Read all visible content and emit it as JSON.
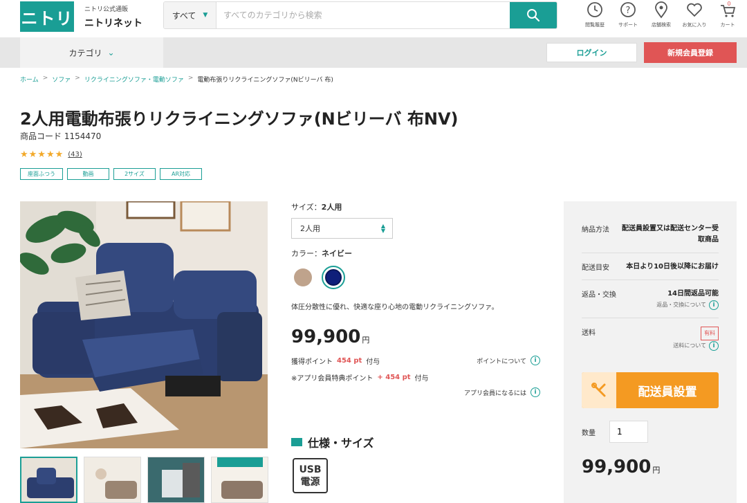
{
  "header": {
    "logo_text": "ニトリ",
    "brand_small": "ニトリ公式通販",
    "brand_name": "ニトリネット",
    "search_category": "すべて",
    "search_placeholder": "すべてのカテゴリから検索",
    "icons": [
      {
        "name": "history-icon",
        "label": "閲覧履歴"
      },
      {
        "name": "support-icon",
        "label": "サポート"
      },
      {
        "name": "store-icon",
        "label": "店舗検索"
      },
      {
        "name": "favorite-icon",
        "label": "お気に入り"
      },
      {
        "name": "cart-icon",
        "label": "カート",
        "count": "0"
      }
    ]
  },
  "subnav": {
    "category_label": "カテゴリ",
    "login_label": "ログイン",
    "register_label": "新規会員登録"
  },
  "breadcrumb": [
    "ホーム",
    "ソファ",
    "リクライニングソファ・電動ソファ",
    "電動布張りリクライニングソファ(Nビリーバ 布)"
  ],
  "product": {
    "title": "2人用電動布張りリクライニングソファ(Nビリーバ 布NV)",
    "code_label": "商品コード",
    "code": "1154470",
    "stars": "★★★★★",
    "review_count": "(43)",
    "tags": [
      "座面ふつう",
      "動画",
      "2サイズ",
      "AR対応"
    ],
    "size_label": "サイズ：",
    "size_value": "2人用",
    "size_select": "2人用",
    "color_label": "カラー：",
    "color_value": "ネイビー",
    "description": "体圧分散性に優れ、快適な座り心地の電動リクライニングソファ。",
    "price": "99,900",
    "yen": "円",
    "points_label": "獲得ポイント",
    "points_value": "454 pt",
    "points_suffix": "付与",
    "points_about": "ポイントについて",
    "app_points_label": "※アプリ会員特典ポイント",
    "app_points_value": "+ 454 pt",
    "app_points_suffix": "付与",
    "app_member_link": "アプリ会員になるには",
    "spec_title": "仕様・サイズ",
    "usb_line1": "USB",
    "usb_line2": "電源"
  },
  "panel": {
    "rows": [
      {
        "key": "納品方法",
        "value": "配送員設置又は配送センター受取商品"
      },
      {
        "key": "配送目安",
        "value": "本日より10日後以降にお届け"
      },
      {
        "key": "返品・交換",
        "value": "14日間返品可能",
        "sub": "返品・交換について"
      },
      {
        "key": "送料",
        "badge": "有料",
        "sub": "送料について"
      }
    ],
    "delivery_button": "配送員設置",
    "qty_label": "数量",
    "qty_value": "1",
    "price": "99,900",
    "yen": "円"
  },
  "colors": {
    "brand": "#1a9e95",
    "register": "#e05555",
    "delivery": "#f49a22",
    "swatch_beige": "#bfa38c",
    "swatch_navy": "#0f1f7a"
  }
}
